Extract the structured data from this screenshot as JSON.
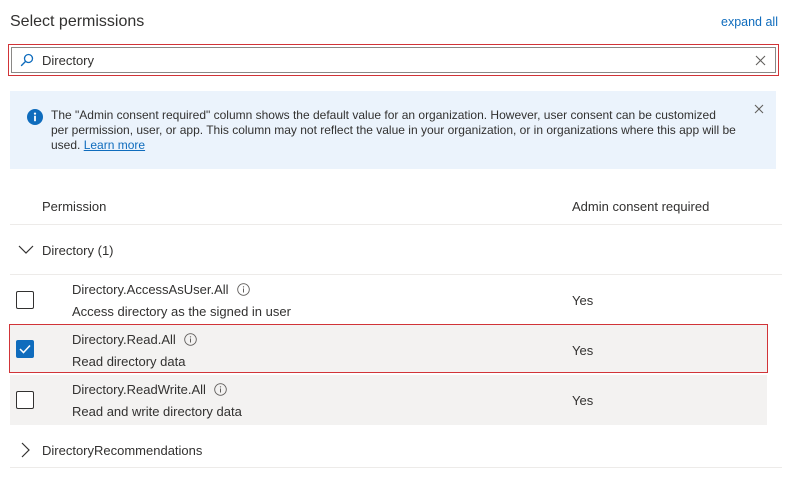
{
  "header": {
    "title": "Select permissions",
    "expand_all": "expand all"
  },
  "search": {
    "value": "Directory",
    "placeholder": ""
  },
  "info_banner": {
    "text": "The \"Admin consent required\" column shows the default value for an organization. However, user consent can be customized per permission, user, or app. This column may not reflect the value in your organization, or in organizations where this app will be used.",
    "link": "Learn more"
  },
  "table": {
    "columns": [
      "Permission",
      "Admin consent required"
    ],
    "groups": [
      {
        "label": "Directory (1)",
        "expanded": true,
        "permissions": [
          {
            "name": "Directory.AccessAsUser.All",
            "description": "Access directory as the signed in user",
            "consent": "Yes",
            "checked": false
          },
          {
            "name": "Directory.Read.All",
            "description": "Read directory data",
            "consent": "Yes",
            "checked": true
          },
          {
            "name": "Directory.ReadWrite.All",
            "description": "Read and write directory data",
            "consent": "Yes",
            "checked": false
          }
        ]
      },
      {
        "label": "DirectoryRecommendations",
        "expanded": false
      }
    ]
  },
  "colors": {
    "accent": "#0f6cbd",
    "highlight_border": "#d13438",
    "banner_bg": "#ebf3fc",
    "row_bg": "#f3f2f1"
  }
}
